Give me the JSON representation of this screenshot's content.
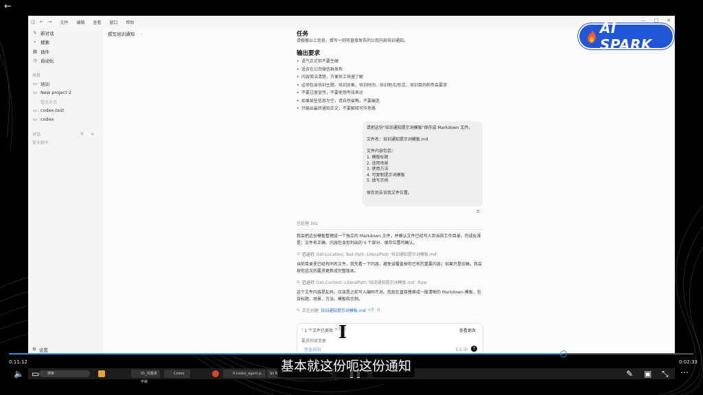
{
  "window": {
    "menu": [
      "文件",
      "编辑",
      "查看",
      "窗口",
      "帮助"
    ]
  },
  "sidebar": {
    "items": [
      {
        "icon": "new-chat-icon",
        "label": "新对话"
      },
      {
        "icon": "search-icon",
        "label": "搜索"
      },
      {
        "icon": "plugin-icon",
        "label": "插件"
      },
      {
        "icon": "automation-icon",
        "label": "自动化"
      }
    ],
    "projects_heading": "项目",
    "projects": [
      {
        "label": "培训"
      },
      {
        "label": "New project 2",
        "sub": "暂无对话"
      },
      {
        "label": "codex-test"
      },
      {
        "label": "codex"
      }
    ],
    "threads_heading": "对话",
    "threads_empty": "暂无聊天",
    "settings_label": "设置"
  },
  "thread": {
    "title": "撰写培训通知"
  },
  "chat": {
    "task_heading": "任务",
    "task_text": "请根据以上信息，撰写一则可直接发布的公司内部培训通知。",
    "output_heading": "输出要求",
    "requirements": [
      "语气正式但不要生硬",
      "适合在公司微信群发布",
      "内容简洁清楚，方便员工快速了解",
      "必须包含培训主题、培训对象、培训时间、培训地点/形式、培训目的和参会要求",
      "不要过度宣传，不要使用夸张表达",
      "如果某些信息为空，请自然省略，不要编造",
      "只输出最终通知正文，不要解释写作思路"
    ],
    "user_message": {
      "lines": [
        "请把这份\"培训通知提示词模板\"保存成 Markdown 文件。",
        "",
        "文件名：培训通知提示词模板.md",
        "",
        "文件内容包括：",
        "1. 模板标题",
        "2. 适用场景",
        "3. 使用方法",
        "4. 可复制提示词模板",
        "5. 填写示例",
        "",
        "保存后告诉我文件位置。"
      ]
    },
    "processed": "已处理 30s",
    "reply_1": "我会把这份模板整理成一个独立的 Markdown 文件，并确认文件已经写入到当前工作目录。完成标准是：文件名正确、内容包含你列出的 5 个部分、保存位置可确认。",
    "cmd_1_status": "已运行",
    "cmd_1_text": "Get-Location; Test-Path -LiteralPath '培训通知提示词模板.md'",
    "reply_2": "当前目录里已经有同名文件，我先看一下内容，避免误覆盖掉你已有的重要内容；如果只是旧稿，我会按你这次的要求更新成完整版本。",
    "cmd_2_status": "已运行",
    "cmd_2_text": "Get-Content -LiteralPath '培训通知提示词模板.md' -Raw",
    "reply_3": "这个文件内容是乱码，应该是之前写入编码不对。我现在直接替换成一版清晰的 Markdown 模板，包含标题、场景、方法、模板和示例。",
    "edit_status": "正在创建",
    "edit_file": "培训通知提示词模板.md",
    "edit_add": "+7",
    "edit_remove": "-0"
  },
  "composer": {
    "changes_label": "1 个文件已更改",
    "changes_add": "+7",
    "changes_remove": "-0",
    "view_changes": "查看更改",
    "placeholder": "要求后续变更",
    "mode": "完全访问",
    "model": "5.5 中"
  },
  "badge": {
    "text": "AI SPARK"
  },
  "taskbar": {
    "search": "搜索",
    "apps": [
      "01_完整讲学稿",
      "Codex",
      "4 codex_agent.p...",
      "Sh N"
    ]
  },
  "player": {
    "current_time": "0:11:12",
    "total_time": "0:02:33",
    "progress": 0.81,
    "skip_back": "10",
    "skip_forward": "30",
    "subtitle": "基本就这份呃这份通知"
  }
}
